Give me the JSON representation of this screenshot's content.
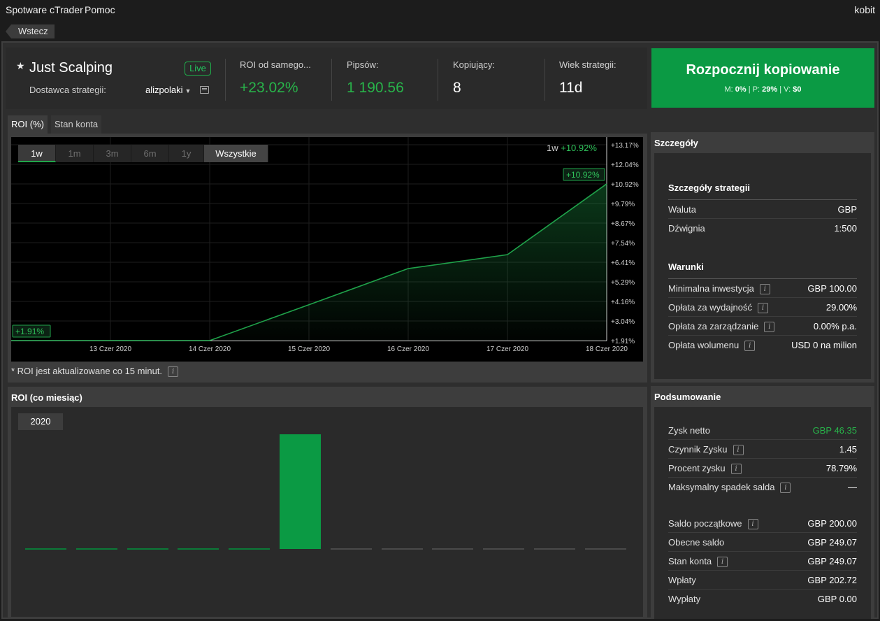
{
  "app": {
    "brand": "Spotware cTrader",
    "help": "Pomoc",
    "user": "kobit",
    "back": "Wstecz"
  },
  "strategy": {
    "name": "Just Scalping",
    "badge": "Live",
    "provider_label": "Dostawca strategii:",
    "provider_name": "alizpolaki",
    "icons": {
      "favorite": "star-icon",
      "message": "message-icon",
      "dropdown": "chevron-down-icon"
    }
  },
  "stats": [
    {
      "label": "ROI od samego...",
      "value": "+23.02%",
      "color": "#28b44a"
    },
    {
      "label": "Pipsów:",
      "value": "1 190.56",
      "color": "#28b44a"
    },
    {
      "label": "Kopiujący:",
      "value": "8",
      "color": "#ffffff"
    },
    {
      "label": "Wiek strategii:",
      "value": "11d",
      "color": "#ffffff"
    }
  ],
  "copy_button": {
    "title": "Rozpocznij kopiowanie",
    "m_label": "M:",
    "m": "0%",
    "p_label": "P:",
    "p": "29%",
    "v_label": "V:",
    "v": "$0",
    "color": "#0b9a44"
  },
  "tabs": [
    "ROI (%)",
    "Stan konta"
  ],
  "chart": {
    "ranges": [
      "1w",
      "1m",
      "3m",
      "6m",
      "1y",
      "Wszystkie"
    ],
    "selected_range": "1w",
    "legend_period": "1w",
    "legend_value": "+10.92%",
    "note": "* ROI jest aktualizowane co 15 minut."
  },
  "chart_data": {
    "type": "area",
    "x": [
      "2020-06-12",
      "2020-06-13",
      "2020-06-14",
      "2020-06-15",
      "2020-06-16",
      "2020-06-17",
      "2020-06-18"
    ],
    "x_tick_labels": [
      "13 Czer 2020",
      "14 Czer 2020",
      "15 Czer 2020",
      "16 Czer 2020",
      "17 Czer 2020",
      "18 Czer 2020"
    ],
    "series": [
      {
        "values": [
          1.91,
          1.91,
          1.91,
          3.97,
          6.05,
          6.85,
          10.92
        ]
      }
    ],
    "y_tick_labels": [
      "+13.17%",
      "+12.04%",
      "+10.92%",
      "+9.79%",
      "+8.67%",
      "+7.54%",
      "+6.41%",
      "+5.29%",
      "+4.16%",
      "+3.04%",
      "+1.91%"
    ],
    "ylim": [
      1.91,
      13.17
    ],
    "start_label": "+1.91%",
    "end_label": "+10.92%",
    "grid": true,
    "color": "#1fa24a"
  },
  "details": {
    "title": "Szczegóły",
    "strategy_section": "Szczegóły strategii",
    "strategy_rows": [
      {
        "k": "Waluta",
        "v": "GBP"
      },
      {
        "k": "Dźwignia",
        "v": "1:500"
      }
    ],
    "terms_section": "Warunki",
    "terms_rows": [
      {
        "k": "Minimalna inwestycja",
        "v": "GBP 100.00",
        "info": true
      },
      {
        "k": "Opłata za wydajność",
        "v": "29.00%",
        "info": true
      },
      {
        "k": "Opłata za zarządzanie",
        "v": "0.00% p.a.",
        "info": true
      },
      {
        "k": "Opłata wolumenu",
        "v": "USD 0 na milion",
        "info": true
      }
    ]
  },
  "summary": {
    "title": "Podsumowanie",
    "rows1": [
      {
        "k": "Zysk netto",
        "v": "GBP 46.35",
        "green": true
      },
      {
        "k": "Czynnik Zysku",
        "v": "1.45",
        "info": true
      },
      {
        "k": "Procent zysku",
        "v": "78.79%",
        "info": true
      },
      {
        "k": "Maksymalny spadek salda",
        "v": "—",
        "info": true
      }
    ],
    "rows2": [
      {
        "k": "Saldo początkowe",
        "v": "GBP 200.00",
        "info": true
      },
      {
        "k": "Obecne saldo",
        "v": "GBP 249.07"
      },
      {
        "k": "Stan konta",
        "v": "GBP 249.07",
        "info": true
      },
      {
        "k": "Wpłaty",
        "v": "GBP 202.72"
      },
      {
        "k": "Wypłaty",
        "v": "GBP 0.00"
      }
    ]
  },
  "monthly": {
    "title": "ROI (co miesiąc)",
    "year": "2020",
    "chart_data": {
      "type": "bar",
      "categories": [
        "1",
        "2",
        "3",
        "4",
        "5",
        "6",
        "7",
        "8",
        "9",
        "10",
        "11",
        "12"
      ],
      "values": [
        0,
        0,
        0,
        0,
        0,
        23.02,
        null,
        null,
        null,
        null,
        null,
        null
      ],
      "color": "#0b9a44"
    }
  }
}
